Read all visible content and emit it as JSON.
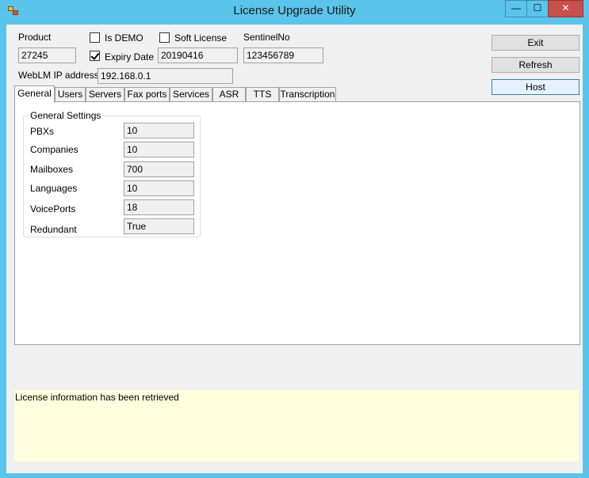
{
  "window": {
    "title": "License Upgrade Utility",
    "min_glyph": "—",
    "max_glyph": "☐",
    "close_glyph": "✕"
  },
  "top": {
    "product_label": "Product",
    "product_value": "27245",
    "is_demo_label": "Is DEMO",
    "is_demo_checked": false,
    "expiry_label": "Expiry Date",
    "expiry_checked": true,
    "expiry_value": "20190416",
    "soft_license_label": "Soft License",
    "soft_license_checked": false,
    "sentinel_label": "SentinelNo",
    "sentinel_value": "123456789",
    "weblm_label": "WebLM IP address",
    "weblm_value": "192.168.0.1"
  },
  "buttons": {
    "exit": "Exit",
    "refresh": "Refresh",
    "host": "Host"
  },
  "tabs": [
    "General",
    "Users",
    "Servers",
    "Fax ports",
    "Services",
    "ASR",
    "TTS",
    "Transcription"
  ],
  "general": {
    "group_title": "General Settings",
    "rows": [
      {
        "label": "PBXs",
        "value": "10"
      },
      {
        "label": "Companies",
        "value": "10"
      },
      {
        "label": "Mailboxes",
        "value": "700"
      },
      {
        "label": "Languages",
        "value": "10"
      },
      {
        "label": "VoicePorts",
        "value": "18"
      },
      {
        "label": "Redundant",
        "value": "True"
      }
    ]
  },
  "status": {
    "message": "License information has been retrieved"
  },
  "colors": {
    "frame": "#5bc4ea",
    "close": "#c7504b",
    "status_bg": "#ffffe0"
  }
}
